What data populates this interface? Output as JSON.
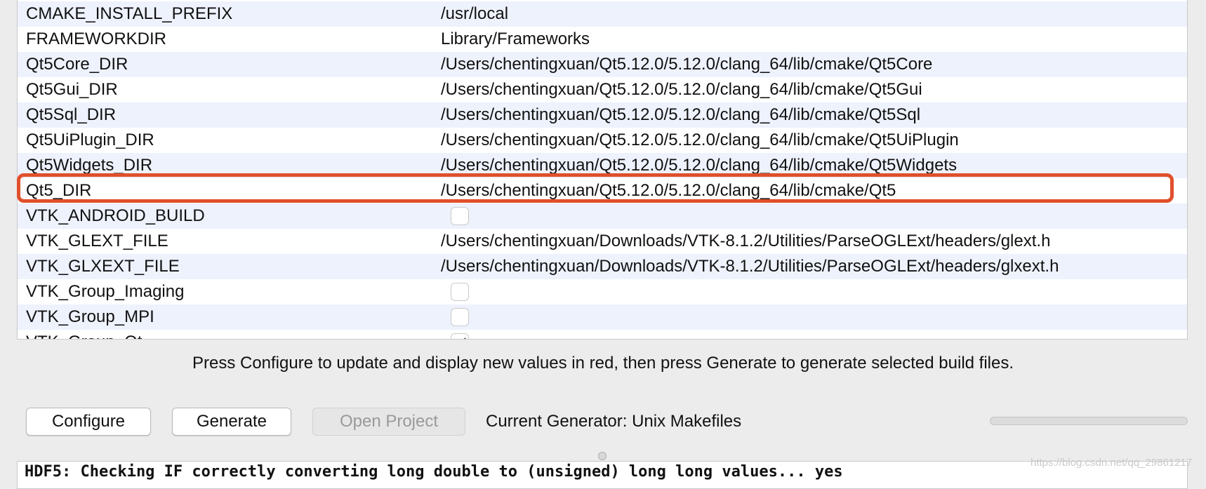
{
  "cache_table": {
    "rows": [
      {
        "name": "CMAKE_INSTALL_PREFIX",
        "type": "text",
        "value": "/usr/local"
      },
      {
        "name": "FRAMEWORKDIR",
        "type": "text",
        "value": "Library/Frameworks"
      },
      {
        "name": "Qt5Core_DIR",
        "type": "text",
        "value": "/Users/chentingxuan/Qt5.12.0/5.12.0/clang_64/lib/cmake/Qt5Core"
      },
      {
        "name": "Qt5Gui_DIR",
        "type": "text",
        "value": "/Users/chentingxuan/Qt5.12.0/5.12.0/clang_64/lib/cmake/Qt5Gui"
      },
      {
        "name": "Qt5Sql_DIR",
        "type": "text",
        "value": "/Users/chentingxuan/Qt5.12.0/5.12.0/clang_64/lib/cmake/Qt5Sql"
      },
      {
        "name": "Qt5UiPlugin_DIR",
        "type": "text",
        "value": "/Users/chentingxuan/Qt5.12.0/5.12.0/clang_64/lib/cmake/Qt5UiPlugin"
      },
      {
        "name": "Qt5Widgets_DIR",
        "type": "text",
        "value": "/Users/chentingxuan/Qt5.12.0/5.12.0/clang_64/lib/cmake/Qt5Widgets"
      },
      {
        "name": "Qt5_DIR",
        "type": "text",
        "value": "/Users/chentingxuan/Qt5.12.0/5.12.0/clang_64/lib/cmake/Qt5",
        "highlighted": true
      },
      {
        "name": "VTK_ANDROID_BUILD",
        "type": "bool",
        "checked": false
      },
      {
        "name": "VTK_GLEXT_FILE",
        "type": "text",
        "value": "/Users/chentingxuan/Downloads/VTK-8.1.2/Utilities/ParseOGLExt/headers/glext.h"
      },
      {
        "name": "VTK_GLXEXT_FILE",
        "type": "text",
        "value": "/Users/chentingxuan/Downloads/VTK-8.1.2/Utilities/ParseOGLExt/headers/glxext.h"
      },
      {
        "name": "VTK_Group_Imaging",
        "type": "bool",
        "checked": false
      },
      {
        "name": "VTK_Group_MPI",
        "type": "bool",
        "checked": false
      },
      {
        "name": "VTK_Group_Qt",
        "type": "bool",
        "checked": true
      }
    ]
  },
  "hint_text": "Press Configure to update and display new values in red, then press Generate to generate selected build files.",
  "buttons": {
    "configure": "Configure",
    "generate": "Generate",
    "open_project": "Open Project"
  },
  "generator_text": "Current Generator: Unix Makefiles",
  "progress_value": 0,
  "output": {
    "line": "HDF5: Checking IF correctly converting long double to (unsigned) long long values... yes"
  },
  "watermark": "https://blog.csdn.net/qq_29861217",
  "colors": {
    "highlight_border": "#e0502c",
    "row_alt": "#eef2fd"
  }
}
